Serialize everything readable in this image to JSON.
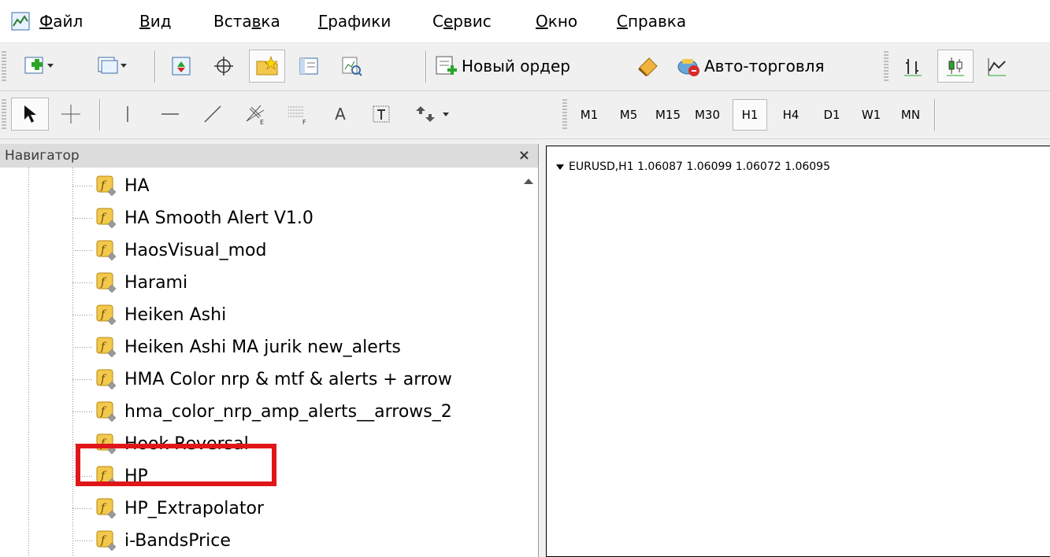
{
  "menu": {
    "items": [
      {
        "label": "Файл"
      },
      {
        "label": "Вид"
      },
      {
        "label": "Вставка"
      },
      {
        "label": "Графики"
      },
      {
        "label": "Сервис"
      },
      {
        "label": "Окно"
      },
      {
        "label": "Справка"
      }
    ]
  },
  "toolbar": {
    "new_order_label": "Новый ордер",
    "autotrade_label": "Авто-торговля",
    "icons": [
      "new-chart-icon",
      "profiles-icon",
      "market-watch-icon",
      "crosshair-icon",
      "navigator-icon",
      "terminal-icon",
      "strategy-tester-icon",
      "new-order-icon",
      "metaeditor-icon",
      "autotrading-icon",
      "bar-chart-icon",
      "candlestick-icon",
      "line-chart-icon"
    ]
  },
  "drawing_toolbar": {
    "text_tool_label": "A",
    "icons": [
      "cursor-icon",
      "crosshair-icon",
      "vertical-line-icon",
      "horizontal-line-icon",
      "trendline-icon",
      "fibo-fan-icon",
      "fibo-retracement-icon",
      "text-icon",
      "text-label-icon",
      "arrows-icon"
    ]
  },
  "timeframes": [
    "M1",
    "M5",
    "M15",
    "M30",
    "H1",
    "H4",
    "D1",
    "W1",
    "MN"
  ],
  "timeframe_selected": "H1",
  "navigator": {
    "title": "Навигатор",
    "close": "×",
    "items": [
      "HA",
      "HA Smooth Alert V1.0",
      "HaosVisual_mod",
      "Harami",
      "Heiken Ashi",
      "Heiken Ashi MA jurik new_alerts",
      "HMA Color nrp & mtf & alerts + arrow",
      "hma_color_nrp_amp_alerts__arrows_2",
      "Hook Reversal",
      "HP",
      "HP_Extrapolator",
      "i-BandsPrice"
    ],
    "highlighted_item": "Heiken Ashi"
  },
  "chart": {
    "header": "EURUSD,H1  1.06087 1.06099 1.06072 1.06095"
  },
  "colors": {
    "highlight": "#e0161a",
    "icon_fill": "#f2c94c"
  }
}
